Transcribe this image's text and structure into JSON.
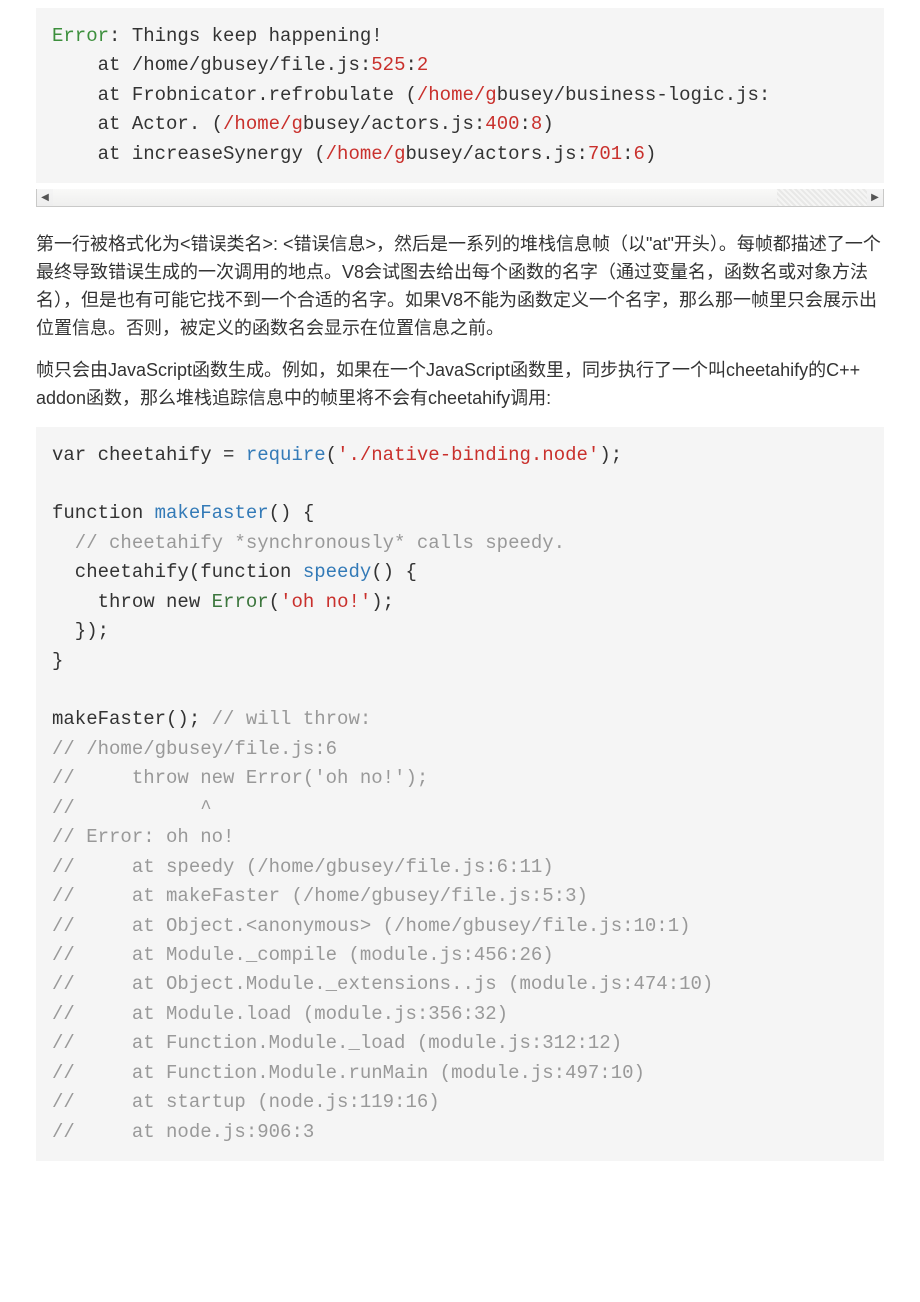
{
  "code1": {
    "err_name": "Error",
    "err_sep": ": ",
    "err_msg": "Things keep happening!",
    "l2_a": "    at /home/gbusey/file.js:",
    "l2_b": "525",
    "l2_c": ":",
    "l2_d": "2",
    "l3_a": "    at Frobnicator.refrobulate (",
    "l3_b": "/home/g",
    "l3_c": "busey/business-logic.js:",
    "l4_a": "    at Actor. (",
    "l4_b": "/home/g",
    "l4_c": "busey/actors.js:",
    "l4_d": "400",
    "l4_e": ":",
    "l4_f": "8",
    "l4_g": ")",
    "l5_a": "    at increaseSynergy (",
    "l5_b": "/home/g",
    "l5_c": "busey/actors.js:",
    "l5_d": "701",
    "l5_e": ":",
    "l5_f": "6",
    "l5_g": ")"
  },
  "para1": "第一行被格式化为<错误类名>: <错误信息>，然后是一系列的堆栈信息帧（以\"at\"开头）。每帧都描述了一个最终导致错误生成的一次调用的地点。V8会试图去给出每个函数的名字（通过变量名，函数名或对象方法名），但是也有可能它找不到一个合适的名字。如果V8不能为函数定义一个名字，那么那一帧里只会展示出位置信息。否则，被定义的函数名会显示在位置信息之前。",
  "para2": "帧只会由JavaScript函数生成。例如，如果在一个JavaScript函数里，同步执行了一个叫cheetahify的C++ addon函数，那么堆栈追踪信息中的帧里将不会有cheetahify调用:",
  "code2": {
    "l1_a": "var cheetahify = ",
    "l1_b": "require",
    "l1_c": "(",
    "l1_d": "'./native-binding.node'",
    "l1_e": ");",
    "l3_a": "function ",
    "l3_b": "makeFaster",
    "l3_c": "() {",
    "l4": "  // cheetahify *synchronously* calls speedy.",
    "l5_a": "  cheetahify(function ",
    "l5_b": "speedy",
    "l5_c": "() {",
    "l6_a": "    throw new ",
    "l6_b": "Error",
    "l6_c": "(",
    "l6_d": "'oh no!'",
    "l6_e": ");",
    "l7": "  });",
    "l8": "}",
    "l10_a": "makeFaster(); ",
    "l10_b": "// will throw:",
    "l11": "// /home/gbusey/file.js:6",
    "l12": "//     throw new Error('oh no!');",
    "l13": "//           ^",
    "l14": "// Error: oh no!",
    "l15": "//     at speedy (/home/gbusey/file.js:6:11)",
    "l16": "//     at makeFaster (/home/gbusey/file.js:5:3)",
    "l17": "//     at Object.<anonymous> (/home/gbusey/file.js:10:1)",
    "l18": "//     at Module._compile (module.js:456:26)",
    "l19": "//     at Object.Module._extensions..js (module.js:474:10)",
    "l20": "//     at Module.load (module.js:356:32)",
    "l21": "//     at Function.Module._load (module.js:312:12)",
    "l22": "//     at Function.Module.runMain (module.js:497:10)",
    "l23": "//     at startup (node.js:119:16)",
    "l24": "//     at node.js:906:3"
  }
}
